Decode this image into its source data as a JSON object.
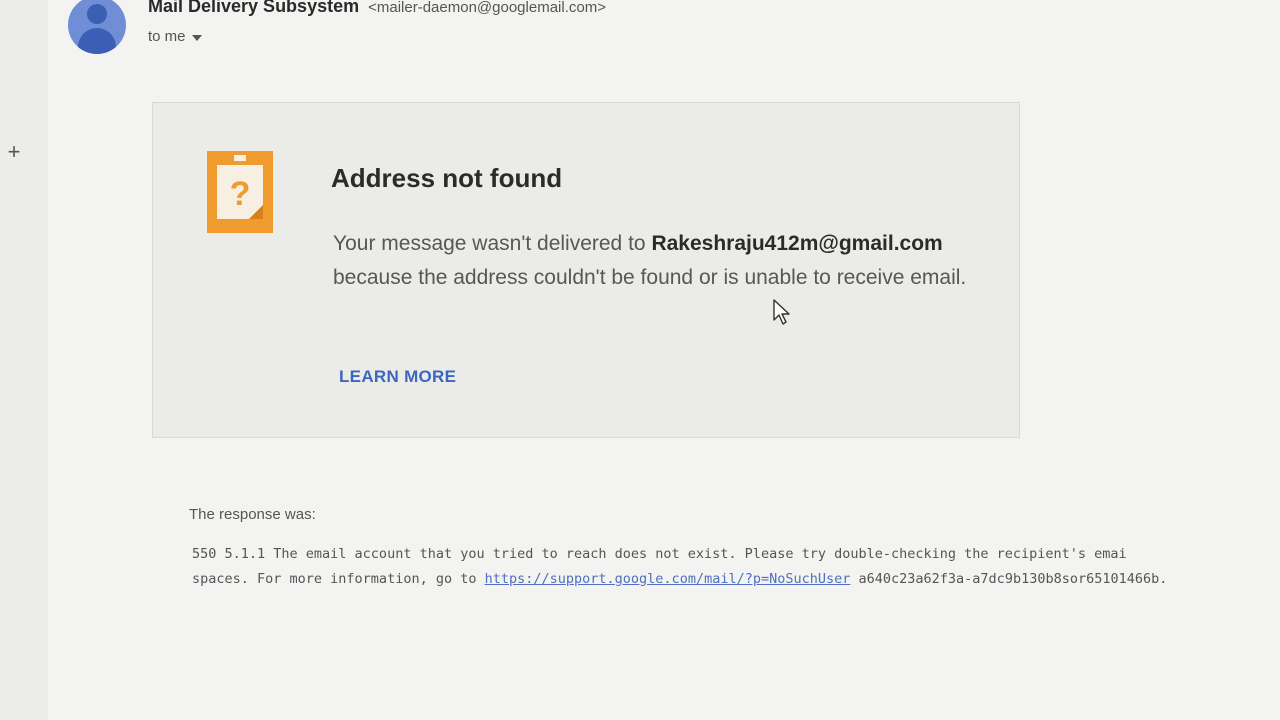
{
  "header": {
    "sender_name": "Mail Delivery Subsystem",
    "sender_email": "<mailer-daemon@googlemail.com>",
    "recipient_label": "to me"
  },
  "card": {
    "title": "Address not found",
    "message_prefix": "Your message wasn't delivered to",
    "address": "Rakeshraju412m@gmail.com",
    "message_suffix": "because the address couldn't be found or is unable to receive email.",
    "learn_more": "LEARN MORE"
  },
  "response": {
    "label": "The response was:",
    "line1": "550 5.1.1 The email account that you tried to reach does not exist. Please try double-checking the recipient's emai",
    "line2_prefix": "spaces. For more information, go to",
    "link": "https://support.google.com/mail/?p=NoSuchUser",
    "line2_suffix": "a640c23a62f3a-a7dc9b130b8sor65101466b."
  },
  "colors": {
    "accent_orange": "#f0a030",
    "link_blue": "#3b66c2",
    "avatar_blue": "#6f8ed6"
  },
  "icons": [
    "plus-icon",
    "avatar-icon",
    "caret-down-icon",
    "question-document-icon",
    "mouse-cursor-icon"
  ]
}
